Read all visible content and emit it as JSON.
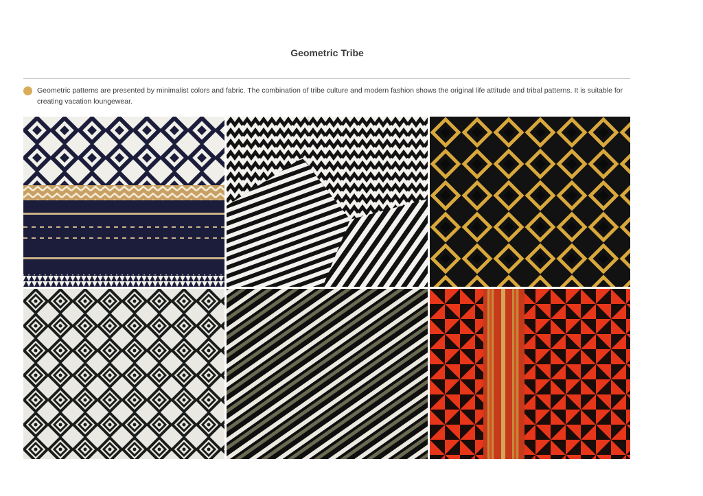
{
  "page": {
    "title": "Geometric Tribe",
    "description": "Geometric patterns are presented by minimalist colors and fabric. The combination of tribe culture and modern fashion shows the original life attitude and tribal patterns. It is suitable for creating vacation loungewear."
  },
  "colors": {
    "bullet": "#d8ac5a",
    "navy": "#1b1d3a",
    "black": "#141414",
    "white": "#f2f0ea",
    "gold": "#d9a83c",
    "olive": "#6b6a52",
    "red": "#e8361a"
  },
  "swatches": [
    {
      "pattern": "navy-white-geometric-knit-with-gold-stripes"
    },
    {
      "pattern": "black-white-zigzag-jacquard"
    },
    {
      "pattern": "black-gold-diamond-lattice"
    },
    {
      "pattern": "black-white-diamond-grid-weave"
    },
    {
      "pattern": "diagonal-black-white-olive-stripes"
    },
    {
      "pattern": "red-black-pinwheel-triangles"
    }
  ]
}
